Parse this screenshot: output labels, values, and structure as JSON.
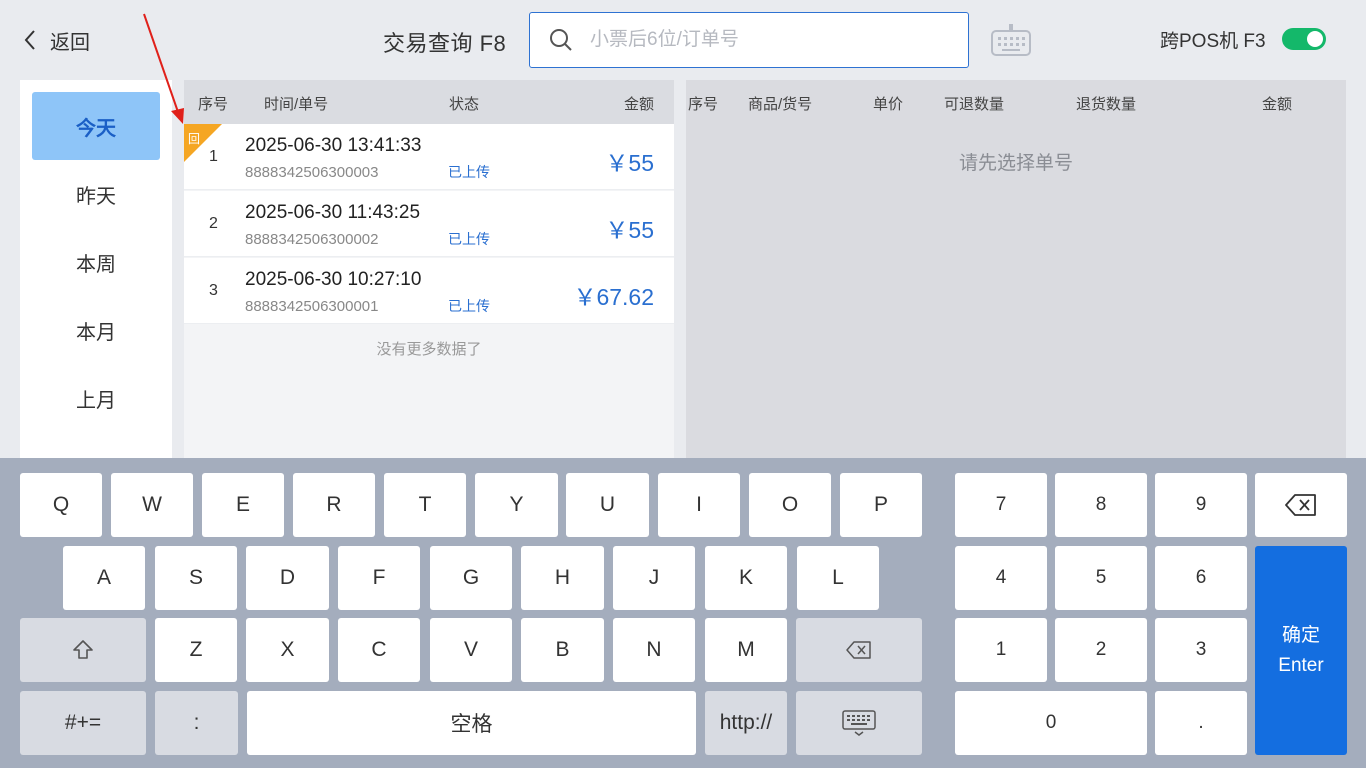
{
  "header": {
    "back_label": "返回",
    "title": "交易查询 F8",
    "search_placeholder": "小票后6位/订单号",
    "cross_pos_label": "跨POS机 F3",
    "cross_pos_enabled": true
  },
  "date_filters": [
    {
      "label": "今天",
      "active": true
    },
    {
      "label": "昨天",
      "active": false
    },
    {
      "label": "本周",
      "active": false
    },
    {
      "label": "本月",
      "active": false
    },
    {
      "label": "上月",
      "active": false
    }
  ],
  "orders": {
    "columns": [
      "序号",
      "时间/单号",
      "状态",
      "金额"
    ],
    "rows": [
      {
        "index": "1",
        "time": "2025-06-30 13:41:33",
        "order_no": "8888342506300003",
        "status": "已上传",
        "amount": "￥55",
        "badge": "回"
      },
      {
        "index": "2",
        "time": "2025-06-30 11:43:25",
        "order_no": "8888342506300002",
        "status": "已上传",
        "amount": "￥55",
        "badge": ""
      },
      {
        "index": "3",
        "time": "2025-06-30 10:27:10",
        "order_no": "8888342506300001",
        "status": "已上传",
        "amount": "￥67.62",
        "badge": ""
      }
    ],
    "no_more": "没有更多数据了"
  },
  "detail": {
    "columns": [
      "序号",
      "商品/货号",
      "单价",
      "可退数量",
      "退货数量",
      "金额"
    ],
    "hint": "请先选择单号"
  },
  "keyboard": {
    "row1": [
      "Q",
      "W",
      "E",
      "R",
      "T",
      "Y",
      "U",
      "I",
      "O",
      "P"
    ],
    "row2": [
      "A",
      "S",
      "D",
      "F",
      "G",
      "H",
      "J",
      "K",
      "L"
    ],
    "row3": [
      "Z",
      "X",
      "C",
      "V",
      "B",
      "N",
      "M"
    ],
    "symbols_label": "#+=",
    "colon_label": ":",
    "space_label": "空格",
    "http_label": "http://",
    "numpad": [
      "7",
      "8",
      "9",
      "4",
      "5",
      "6",
      "1",
      "2",
      "3"
    ],
    "zero_label": "0",
    "dot_label": ".",
    "enter_label_cn": "确定",
    "enter_label_en": "Enter"
  },
  "colors": {
    "accent_blue": "#2a6fd0",
    "enter_blue": "#146ee0",
    "active_filter_bg": "#8ec5f8",
    "toggle_green": "#14b86a",
    "badge_orange": "#f5a623",
    "annotation_arrow_red": "#e0201a"
  },
  "icons": {
    "back": "chevron-left-icon",
    "search": "search-icon",
    "keyboard_toggle": "keyboard-icon",
    "backspace": "backspace-icon",
    "shift": "shift-icon",
    "hide_keyboard": "keyboard-hide-icon"
  }
}
